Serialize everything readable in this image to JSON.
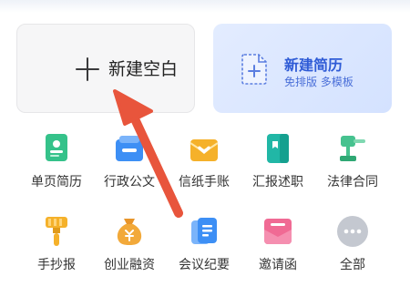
{
  "cards": {
    "blank": {
      "label": "新建空白",
      "icon": "plus-icon"
    },
    "resume": {
      "title": "新建简历",
      "subtitle": "免排版 多模板",
      "icon": "document-plus-icon"
    }
  },
  "grid": [
    {
      "label": "单页简历",
      "icon": "single-resume-icon",
      "color": "#35c28a"
    },
    {
      "label": "行政公文",
      "icon": "official-document-icon",
      "color": "#3d8ff5"
    },
    {
      "label": "信纸手账",
      "icon": "letter-paper-icon",
      "color": "#f5b12a"
    },
    {
      "label": "汇报述职",
      "icon": "report-icon",
      "color": "#21b7a6"
    },
    {
      "label": "法律合同",
      "icon": "gavel-icon",
      "color": "#46c28f"
    },
    {
      "label": "手抄报",
      "icon": "paint-brush-icon",
      "color": "#f5b12a"
    },
    {
      "label": "创业融资",
      "icon": "money-bag-icon",
      "color": "#f2a93a"
    },
    {
      "label": "会议纪要",
      "icon": "meeting-notes-icon",
      "color": "#3d8ff5"
    },
    {
      "label": "邀请函",
      "icon": "invitation-icon",
      "color": "#f06a94"
    },
    {
      "label": "全部",
      "icon": "more-icon",
      "color": "#b9bec8"
    }
  ],
  "annotation_arrow": {
    "icon": "red-arrow-icon",
    "color": "#e8553c"
  }
}
